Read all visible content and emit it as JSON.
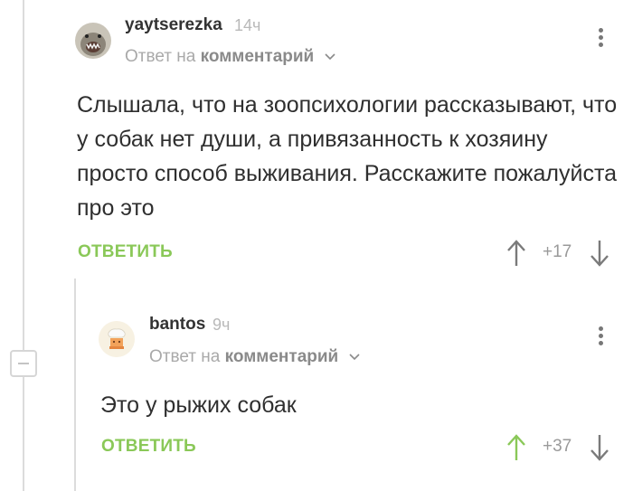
{
  "comments": [
    {
      "username": "yaytserezka",
      "time": "14ч",
      "reply_prefix": "Ответ на",
      "reply_target": "комментарий",
      "text": "Слышала, что на зоопсихологии рассказывают, что у собак нет души, а привязанность к хозяину просто способ выживания. Расскажите пожалуйста про это",
      "reply_label": "ОТВЕТИТЬ",
      "score": "+17",
      "voted_up": false
    },
    {
      "username": "bantos",
      "time": "9ч",
      "reply_prefix": "Ответ на",
      "reply_target": "комментарий",
      "text": "Это у рыжих собак",
      "reply_label": "ОТВЕТИТЬ",
      "score": "+37",
      "voted_up": true
    }
  ],
  "colors": {
    "accent_green": "#8ac858",
    "arrow_gray": "#7a7a7a"
  }
}
